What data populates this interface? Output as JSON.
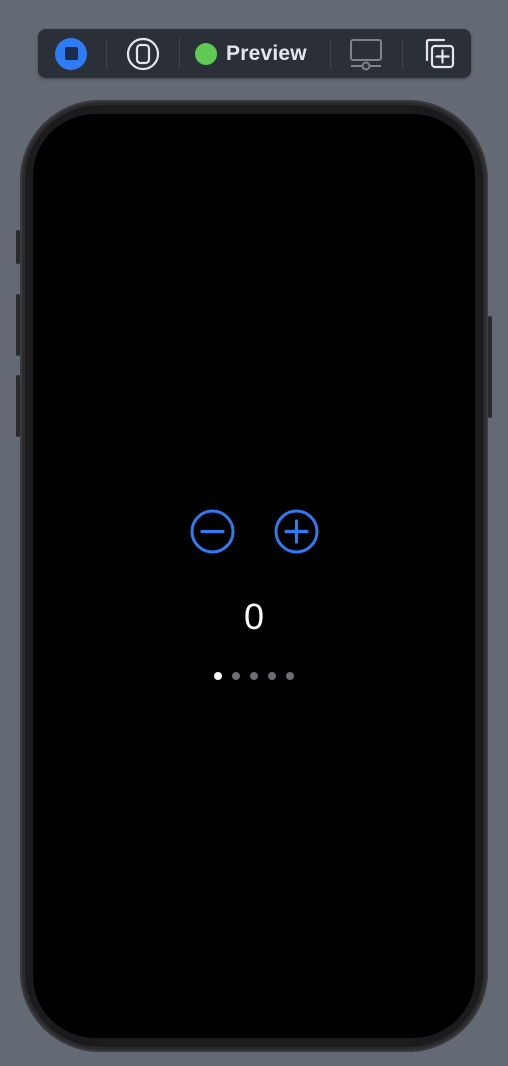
{
  "toolbar": {
    "live_icon": "stop-square-icon",
    "device_icon": "device-frame-icon",
    "preview_label": "Preview",
    "preview_status_color": "#60c954",
    "settings_icon": "device-settings-icon",
    "duplicate_icon": "duplicate-plus-icon"
  },
  "colors": {
    "accent": "#2e7bf4",
    "background": "#636a74",
    "screen": "#000000"
  },
  "app": {
    "decrement_icon": "minus-circle-icon",
    "increment_icon": "plus-circle-icon",
    "counter_value": "0",
    "page_control": {
      "total": 5,
      "current": 1
    }
  }
}
